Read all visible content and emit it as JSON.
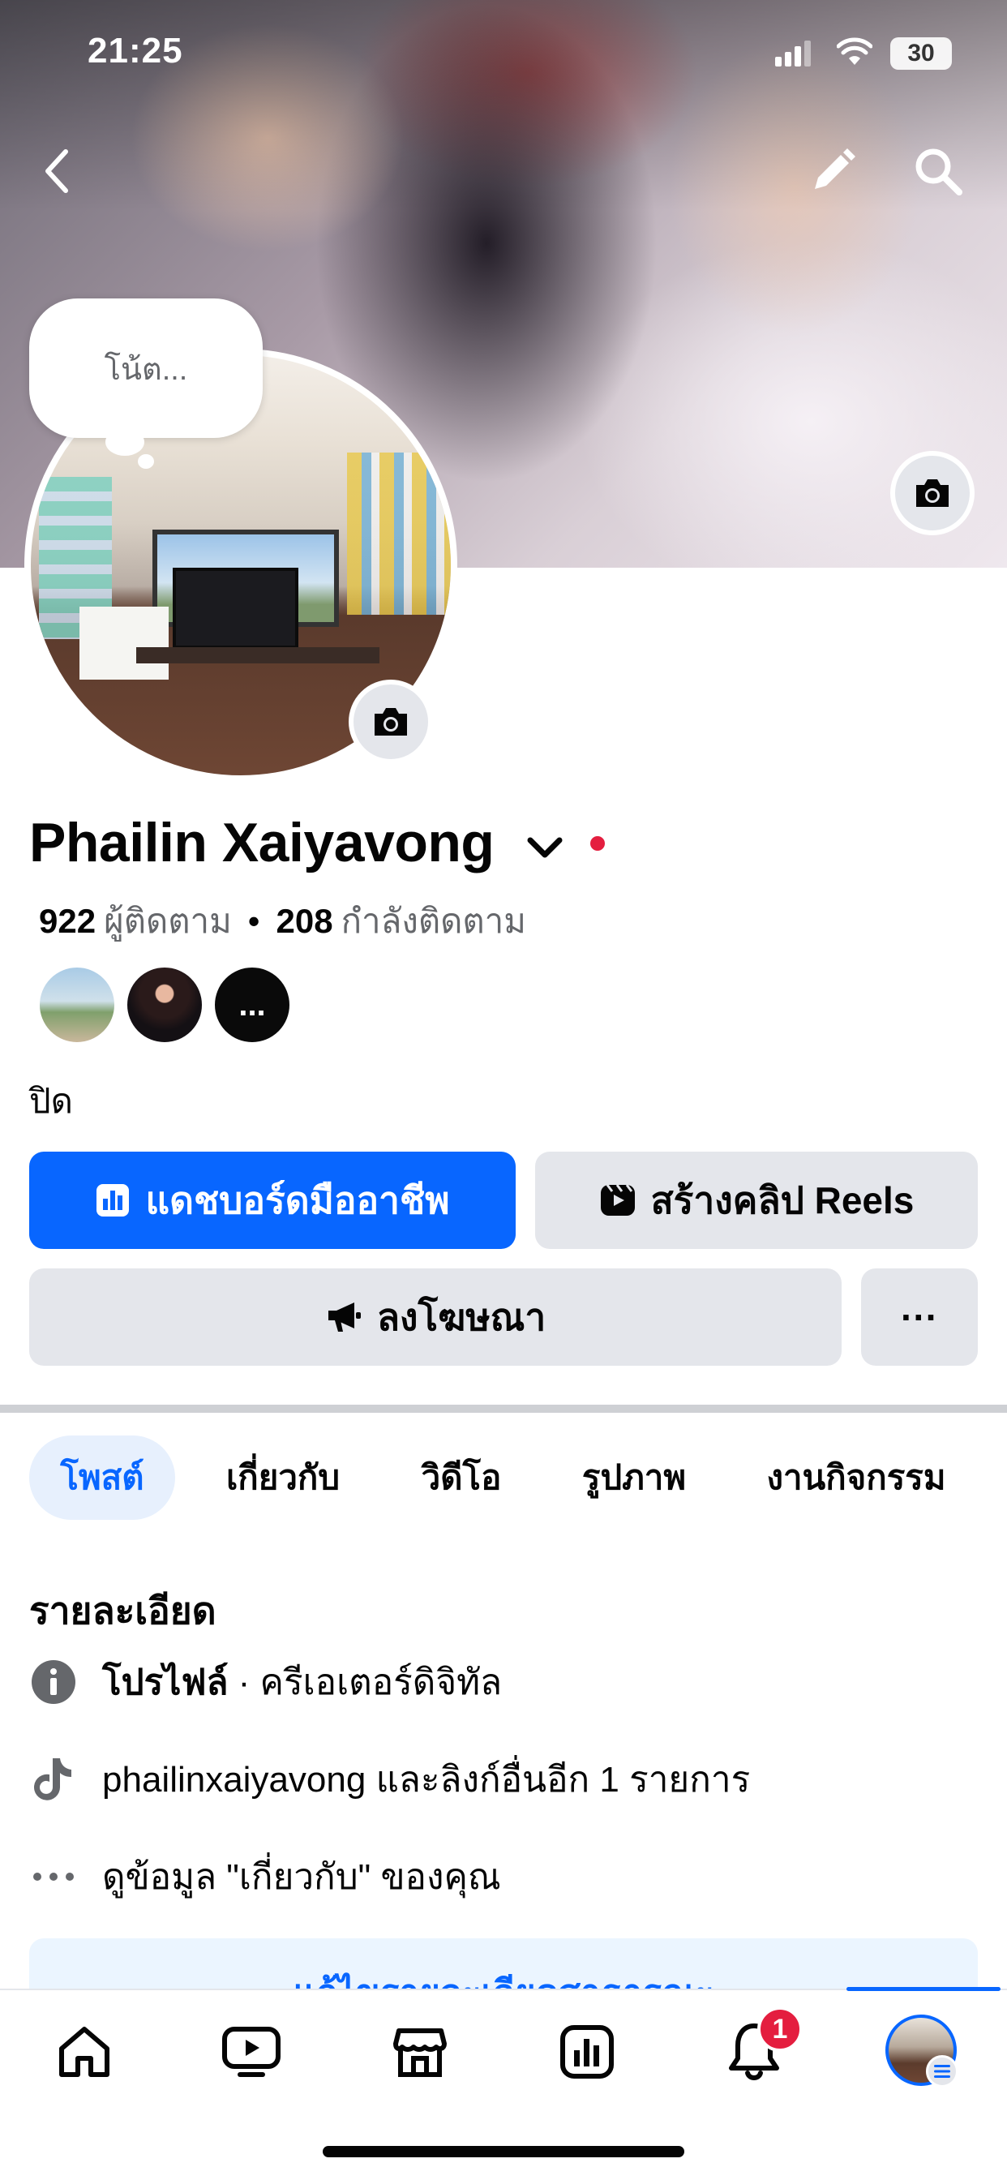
{
  "status_bar": {
    "time": "21:25",
    "battery": "30"
  },
  "cover": {
    "edit_icon": "pencil-icon",
    "search_icon": "search-icon",
    "back_icon": "chevron-left-icon"
  },
  "note_bubble": {
    "placeholder": "โน้ต..."
  },
  "profile": {
    "name": "Phailin Xaiyavong",
    "followers_count": "922",
    "followers_label": "ผู้ติดตาม",
    "separator": "•",
    "following_count": "208",
    "following_label": "กำลังติดตาม",
    "mini_avatar_more": "...",
    "bio": "ปิด"
  },
  "buttons": {
    "dashboard": "แดชบอร์ดมืออาชีพ",
    "create_reels": "สร้างคลิป Reels",
    "advertise": "ลงโฆษณา",
    "more": "···"
  },
  "tabs": [
    {
      "label": "โพสต์",
      "active": true
    },
    {
      "label": "เกี่ยวกับ",
      "active": false
    },
    {
      "label": "วิดีโอ",
      "active": false
    },
    {
      "label": "รูปภาพ",
      "active": false
    },
    {
      "label": "งานกิจกรรม",
      "active": false
    }
  ],
  "details": {
    "title": "รายละเอียด",
    "profile_label": "โปรไฟล์",
    "profile_type": " · ครีเอเตอร์ดิจิทัล",
    "tiktok_text": "phailinxaiyavong และลิงก์อื่นอีก 1 รายการ",
    "about_text": "ดูข้อมูล \"เกี่ยวกับ\" ของคุณ",
    "edit_button": "แก้ไขรายละเอียดสาธารณะ"
  },
  "bottom_nav": {
    "items": [
      "home-icon",
      "video-icon",
      "marketplace-icon",
      "dashboard-icon",
      "bell-icon",
      "profile-avatar"
    ],
    "notification_badge": "1"
  },
  "colors": {
    "accent": "#0866ff",
    "badge": "#e41e3f",
    "button_gray": "#e4e6eb"
  }
}
